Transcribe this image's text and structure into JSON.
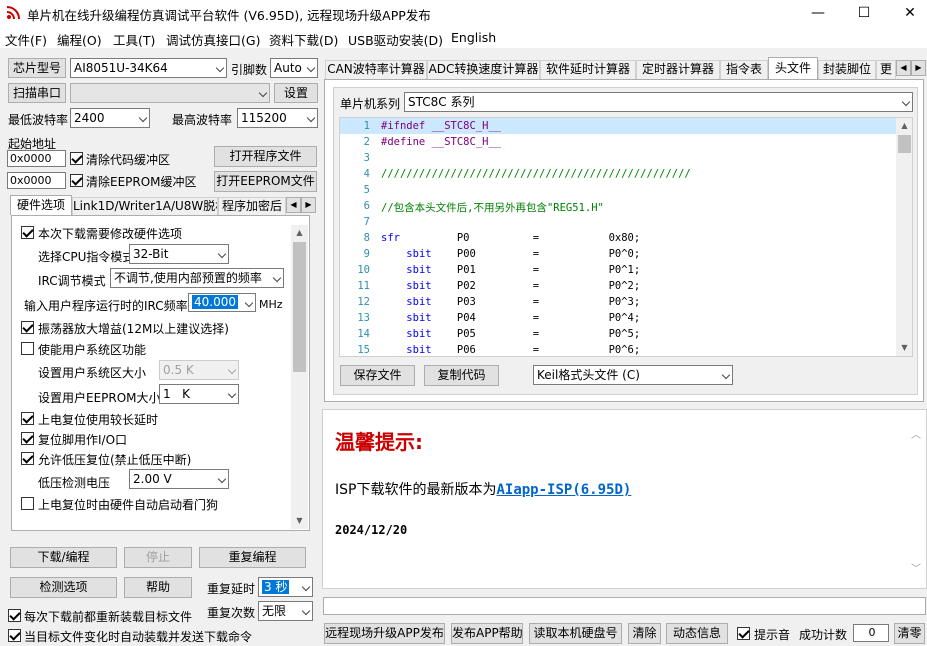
{
  "window": {
    "title": "单片机在线升级编程仿真调试平台软件 (V6.95D), 远程现场升级APP发布",
    "minimize": "—",
    "maximize": "☐",
    "close": "✕"
  },
  "menu": [
    "文件(F)",
    "编程(O)",
    "工具(T)",
    "调试仿真接口(G)",
    "资料下载(D)",
    "USB驱动安装(D)",
    "English"
  ],
  "left": {
    "chip_label": "芯片型号",
    "chip_value": "AI8051U-34K64",
    "pins_label": "引脚数",
    "pins_value": "Auto",
    "port_button": "扫描串口",
    "port_value": "",
    "settings_button": "设置",
    "min_baud_label": "最低波特率",
    "min_baud_value": "2400",
    "max_baud_label": "最高波特率",
    "max_baud_value": "115200",
    "start_addr_label": "起始地址",
    "addr1": "0x0000",
    "clear_code": "清除代码缓冲区",
    "open_program": "打开程序文件",
    "addr2": "0x0000",
    "clear_eeprom": "清除EEPROM缓冲区",
    "open_eeprom": "打开EEPROM文件",
    "tabs": [
      "硬件选项",
      "Link1D/Writer1A/U8W脱机",
      "程序加密后"
    ],
    "hw": {
      "need_modify": "本次下载需要修改硬件选项",
      "cpu_mode_label": "选择CPU指令模式",
      "cpu_mode_value": "32-Bit",
      "irc_mode_label": "IRC调节模式",
      "irc_mode_value": "不调节,使用内部预置的频率",
      "irc_freq_label": "输入用户程序运行时的IRC频率",
      "irc_freq_value": "40.000",
      "irc_unit": "MHz",
      "osc_gain": "振荡器放大增益(12M以上建议选择)",
      "user_sys": "使能用户系统区功能",
      "sys_size_label": "设置用户系统区大小",
      "sys_size_value": "0.5 K",
      "eeprom_size_label": "设置用户EEPROM大小",
      "eeprom_size_value": "1   K",
      "long_delay": "上电复位使用较长延时",
      "reset_io": "复位脚用作I/O口",
      "lvr": "允许低压复位(禁止低压中断)",
      "lv_label": "低压检测电压",
      "lv_value": "2.00 V",
      "wdt": "上电复位时由硬件自动启动看门狗"
    },
    "download_button": "下载/编程",
    "stop_button": "停止",
    "reprogram_button": "重复编程",
    "detect_button": "检测选项",
    "help_button": "帮助",
    "repeat_delay_label": "重复延时",
    "repeat_delay_value": "3 秒",
    "repeat_count_label": "重复次数",
    "repeat_count_value": "无限",
    "reload_before": "每次下载前都重新装载目标文件",
    "auto_send": "当目标文件变化时自动装载并发送下载命令"
  },
  "right": {
    "tabs": [
      "CAN波特率计算器",
      "ADC转换速度计算器",
      "软件延时计算器",
      "定时器计算器",
      "指令表",
      "头文件",
      "封装脚位",
      "更"
    ],
    "series_label": "单片机系列",
    "series_value": "STC8C 系列",
    "code": [
      {
        "n": "1",
        "t": "#ifndef __STC8C_H__",
        "c": "pp"
      },
      {
        "n": "2",
        "t": "#define __STC8C_H__",
        "c": "pp"
      },
      {
        "n": "3",
        "t": "",
        "c": "nm"
      },
      {
        "n": "4",
        "t": "/////////////////////////////////////////////////",
        "c": "cm"
      },
      {
        "n": "5",
        "t": "",
        "c": "nm"
      },
      {
        "n": "6",
        "t": "//包含本头文件后,不用另外再包含\"REG51.H\"",
        "c": "cm"
      },
      {
        "n": "7",
        "t": "",
        "c": "nm"
      },
      {
        "n": "8",
        "t": "sfr         P0          =           0x80;",
        "c": "sfr"
      },
      {
        "n": "9",
        "t": "    sbit    P00         =           P0^0;",
        "c": "sbit"
      },
      {
        "n": "10",
        "t": "    sbit    P01         =           P0^1;",
        "c": "sbit"
      },
      {
        "n": "11",
        "t": "    sbit    P02         =           P0^2;",
        "c": "sbit"
      },
      {
        "n": "12",
        "t": "    sbit    P03         =           P0^3;",
        "c": "sbit"
      },
      {
        "n": "13",
        "t": "    sbit    P04         =           P0^4;",
        "c": "sbit"
      },
      {
        "n": "14",
        "t": "    sbit    P05         =           P0^5;",
        "c": "sbit"
      },
      {
        "n": "15",
        "t": "    sbit    P06         =           P0^6;",
        "c": "sbit"
      }
    ],
    "save_button": "保存文件",
    "copy_button": "复制代码",
    "format_value": "Keil格式头文件 (C)",
    "tip_title": "温馨提示:",
    "tip_text": "ISP下载软件的最新版本为",
    "tip_link": "AIapp-ISP(6.95D)",
    "tip_date": "2024/12/20",
    "bottom": {
      "publish": "远程现场升级APP发布",
      "publish_help": "发布APP帮助",
      "read_disk": "读取本机硬盘号",
      "clear": "清除",
      "dynamic": "动态信息",
      "sound": "提示音",
      "success_label": "成功计数",
      "success_value": "0",
      "clear_count": "清零"
    }
  },
  "colors": {
    "accent": "#cc0000",
    "link": "#0066cc",
    "selection": "#cce8ff"
  }
}
